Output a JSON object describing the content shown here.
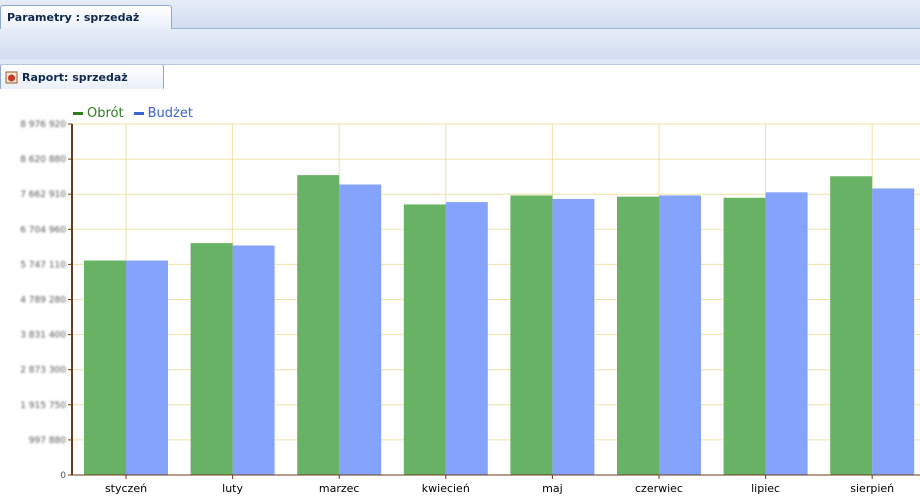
{
  "tabs": {
    "parametry": "Parametry : sprzedaż",
    "raport": "Raport: sprzedaż",
    "raport_icon": "report-icon"
  },
  "colors": {
    "obrot": "#67b264",
    "budzet": "#86a3fb",
    "obrot_legend": "#2e7d1f",
    "budzet_legend": "#3a63d2",
    "grid": "#eee3a6",
    "axis": "#6b3a1a"
  },
  "chart_data": {
    "type": "bar",
    "categories": [
      "styczeń",
      "luty",
      "marzec",
      "kwiecień",
      "maj",
      "czerwiec",
      "lipiec",
      "sierpień"
    ],
    "series": [
      {
        "name": "Obrót",
        "values": [
          5485000,
          5930000,
          7670000,
          6920000,
          7150000,
          7120000,
          7090000,
          7640000
        ]
      },
      {
        "name": "Budżet",
        "values": [
          5485000,
          5870000,
          7430000,
          6980000,
          7060000,
          7150000,
          7230000,
          7330000
        ]
      }
    ],
    "ylim": [
      0,
      8976920
    ],
    "yticks": [
      "0",
      "997 880",
      "1 915 750",
      "2 873 300",
      "3 831 400",
      "4 789 280",
      "5 747 110",
      "6 704 960",
      "7 662 910",
      "8 620 880",
      "8 976 920"
    ],
    "grid": true,
    "legend": "top-left"
  }
}
